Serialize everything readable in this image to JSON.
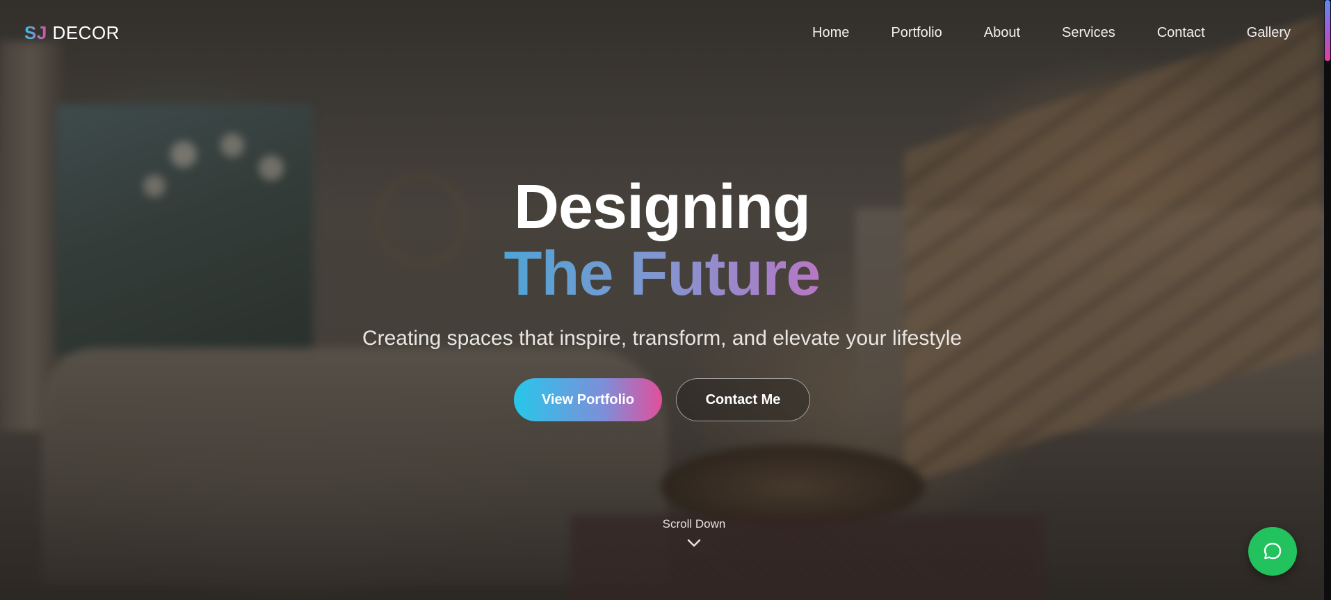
{
  "brand": {
    "mark": "SJ",
    "name": "DECOR"
  },
  "nav": {
    "items": [
      {
        "label": "Home"
      },
      {
        "label": "Portfolio"
      },
      {
        "label": "About"
      },
      {
        "label": "Services"
      },
      {
        "label": "Contact"
      },
      {
        "label": "Gallery"
      }
    ]
  },
  "hero": {
    "headline_line1": "Designing",
    "headline_line2": "The Future",
    "subtitle": "Creating spaces that inspire, transform, and elevate your lifestyle",
    "primary_button": "View Portfolio",
    "secondary_button": "Contact Me"
  },
  "scroll_hint": {
    "label": "Scroll Down",
    "icon": "chevron-down-icon"
  },
  "chat": {
    "icon": "chat-bubble-icon",
    "color": "#22c35e"
  },
  "colors": {
    "accent_start": "#27c7ea",
    "accent_end": "#e14f9d"
  }
}
